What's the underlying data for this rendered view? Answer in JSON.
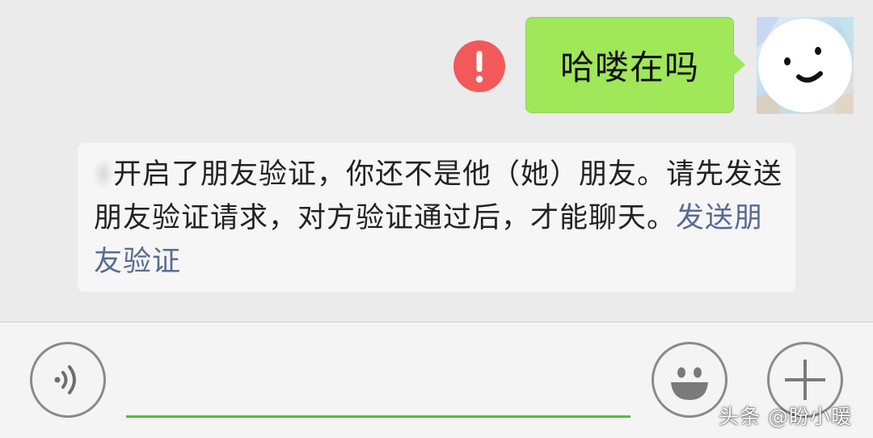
{
  "chat": {
    "outgoing_message": {
      "text": "哈喽在吗",
      "status_icon": "exclamation-error-icon",
      "bubble_color": "#a0e75a",
      "error_color": "#f25a5a"
    },
    "avatar": {
      "icon": "smiley-face-avatar"
    },
    "system_notice": {
      "text": "开启了朋友验证，你还不是他（她）朋友。请先发送朋友验证请求，对方验证通过后，才能聊天。",
      "link_label": "发送朋友验证",
      "link_color": "#576b95"
    }
  },
  "input_bar": {
    "voice_icon": "voice-wave-icon",
    "text_value": "",
    "emoji_icon": "smiley-emoji-icon",
    "more_icon": "plus-icon",
    "accent": "#4fbf39"
  },
  "watermark": {
    "text": "头条 @盼小暖"
  }
}
